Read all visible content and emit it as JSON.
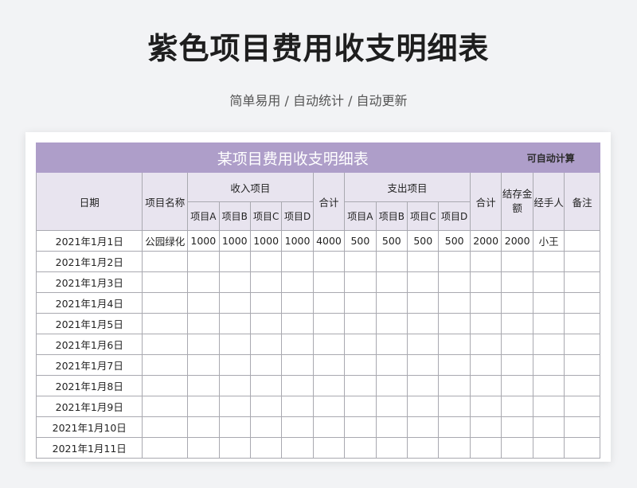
{
  "page": {
    "title": "紫色项目费用收支明细表",
    "subtitle": "简单易用 / 自动统计 / 自动更新"
  },
  "sheet": {
    "title": "某项目费用收支明细表",
    "auto_calc_note": "可自动计算",
    "headers": {
      "date": "日期",
      "project_name": "项目名称",
      "income_group": "收入项目",
      "income_total": "合计",
      "expense_group": "支出项目",
      "expense_total": "合计",
      "balance": "结存金额",
      "handler": "经手人",
      "notes": "备注",
      "sub_a": "项目A",
      "sub_b": "项目B",
      "sub_c": "项目C",
      "sub_d": "项目D"
    },
    "rows": [
      {
        "date": "2021年1月1日",
        "name": "公园绿化",
        "inc_a": "1000",
        "inc_b": "1000",
        "inc_c": "1000",
        "inc_d": "1000",
        "inc_total": "4000",
        "exp_a": "500",
        "exp_b": "500",
        "exp_c": "500",
        "exp_d": "500",
        "exp_total": "2000",
        "balance": "2000",
        "handler": "小王",
        "note": ""
      },
      {
        "date": "2021年1月2日"
      },
      {
        "date": "2021年1月3日"
      },
      {
        "date": "2021年1月4日"
      },
      {
        "date": "2021年1月5日"
      },
      {
        "date": "2021年1月6日"
      },
      {
        "date": "2021年1月7日"
      },
      {
        "date": "2021年1月8日"
      },
      {
        "date": "2021年1月9日"
      },
      {
        "date": "2021年1月10日"
      },
      {
        "date": "2021年1月11日"
      }
    ]
  }
}
